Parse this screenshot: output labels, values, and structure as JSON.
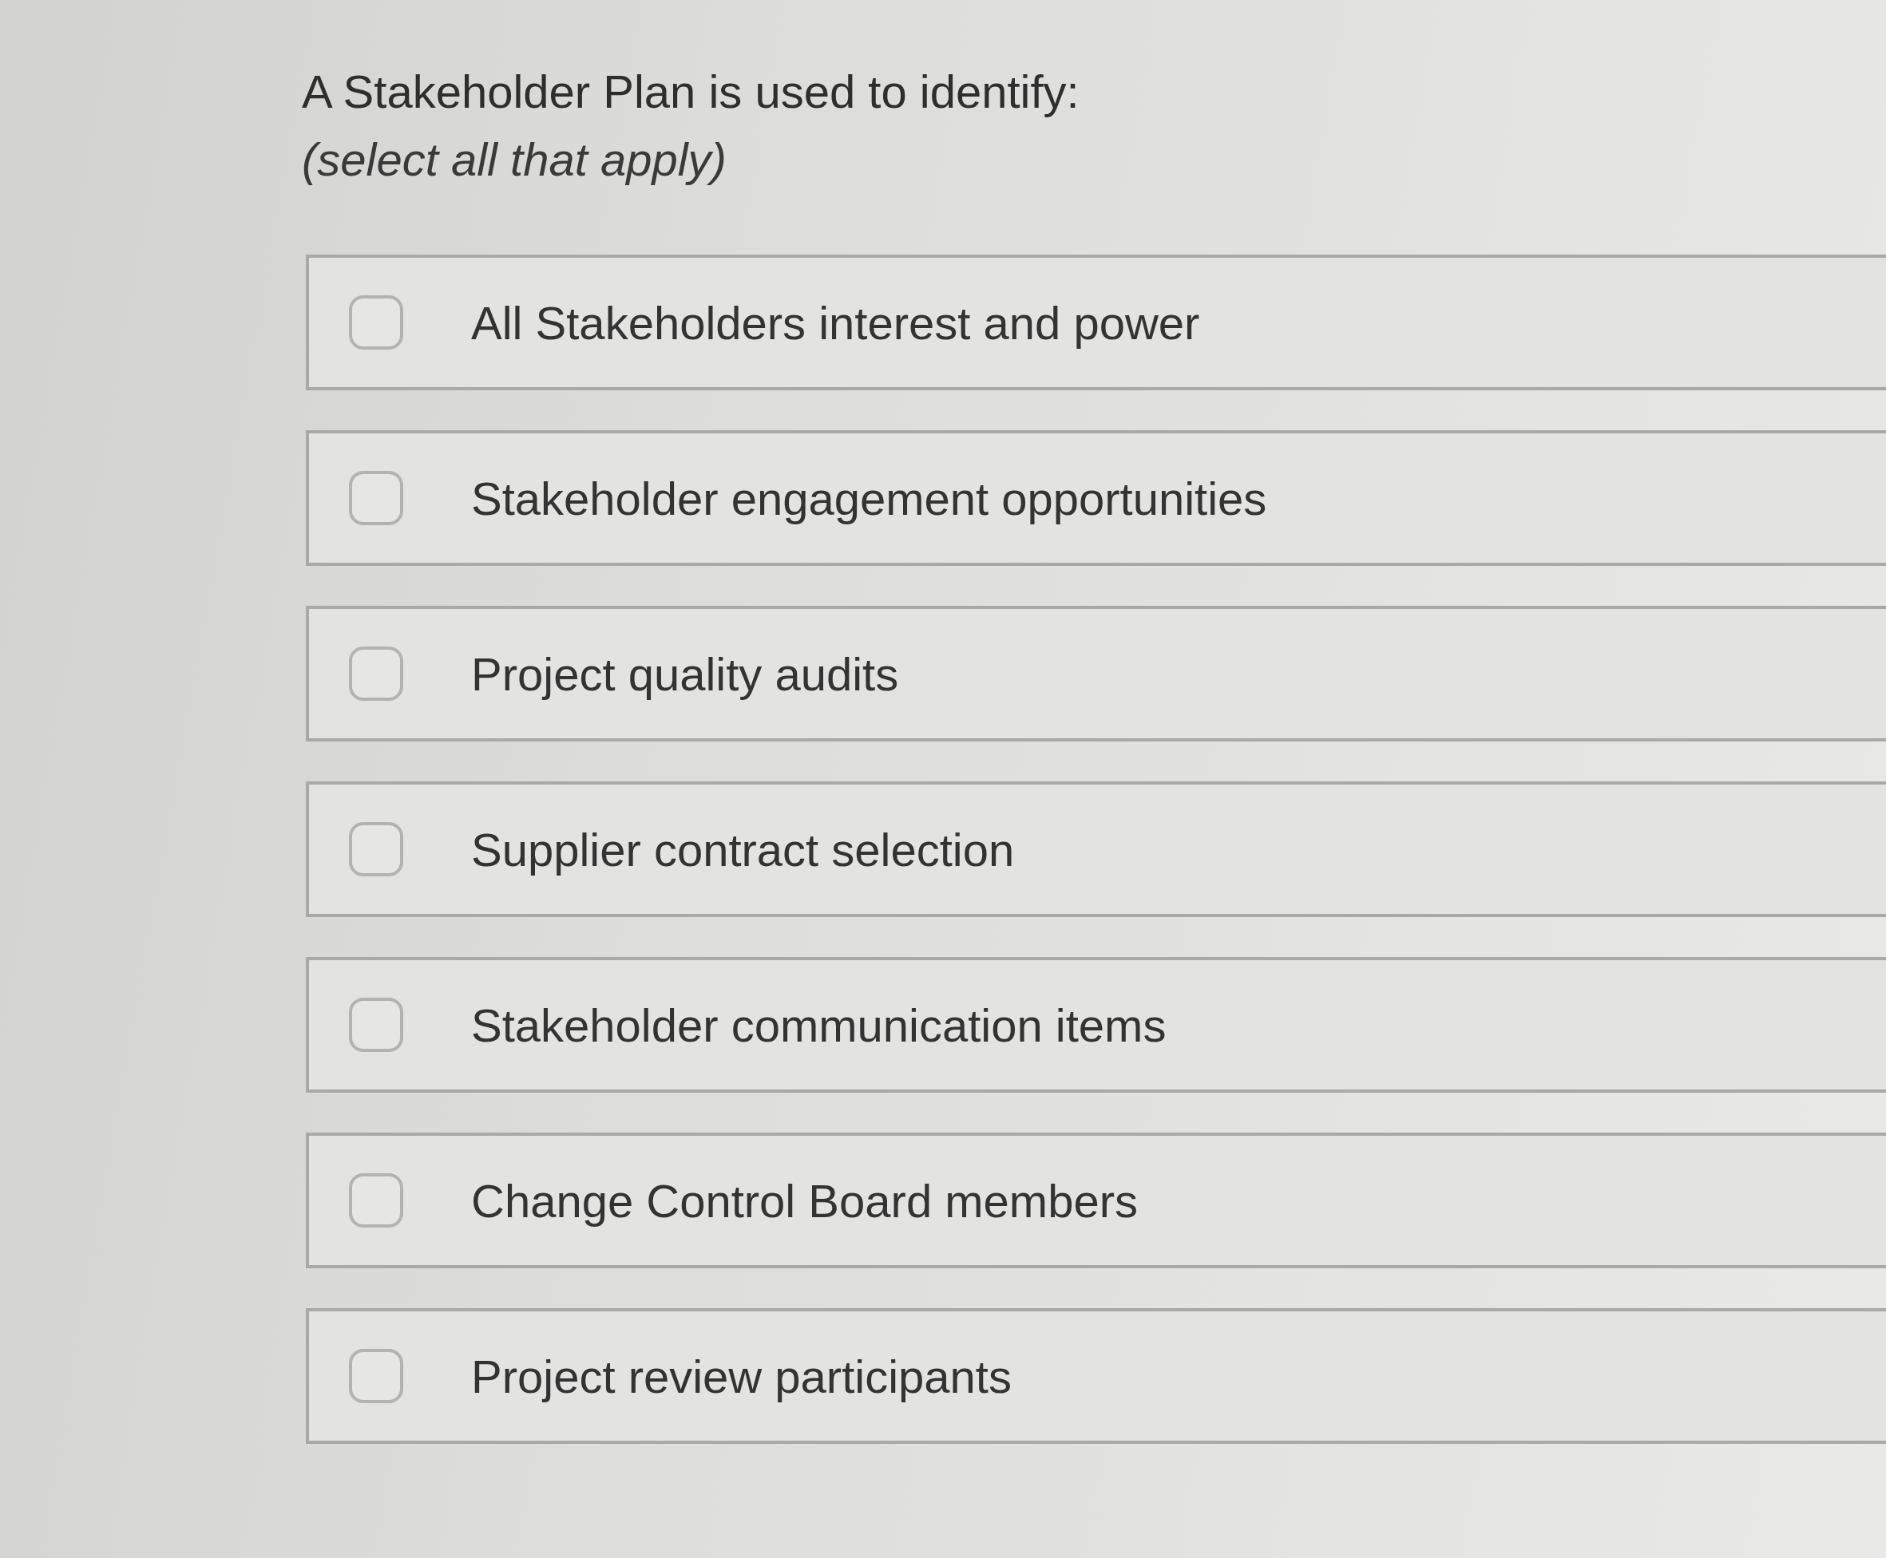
{
  "question": {
    "text": "A Stakeholder Plan is used to identify:",
    "instruction": "(select all that apply)"
  },
  "options": [
    {
      "label": "All Stakeholders interest and power",
      "checked": false
    },
    {
      "label": "Stakeholder engagement opportunities",
      "checked": false
    },
    {
      "label": "Project quality audits",
      "checked": false
    },
    {
      "label": "Supplier contract selection",
      "checked": false
    },
    {
      "label": "Stakeholder communication items",
      "checked": false
    },
    {
      "label": "Change Control Board members",
      "checked": false
    },
    {
      "label": "Project review participants",
      "checked": false
    }
  ]
}
